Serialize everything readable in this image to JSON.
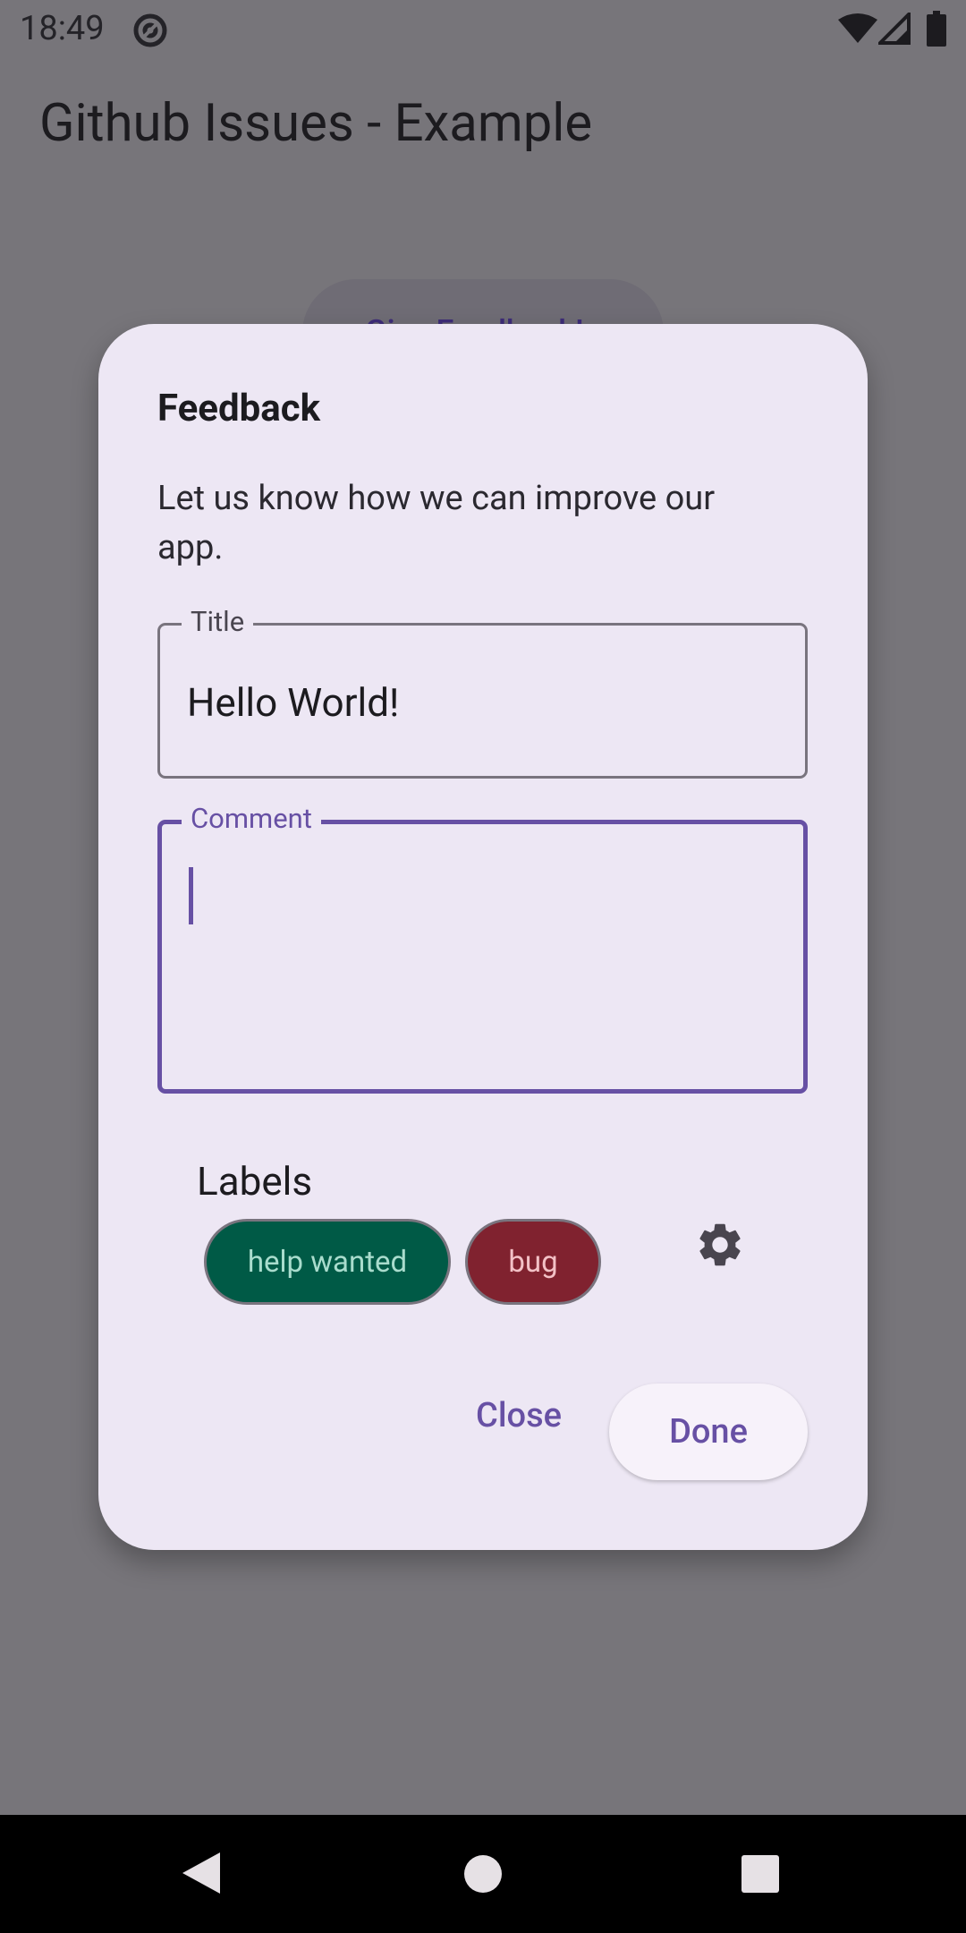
{
  "status_bar": {
    "time": "18:49",
    "icons": [
      "at-sign-icon",
      "wifi-icon",
      "cell-signal-icon",
      "battery-icon"
    ]
  },
  "app_bar": {
    "title": "Github Issues - Example"
  },
  "background": {
    "button_label": "Give Feedback!"
  },
  "dialog": {
    "title": "Feedback",
    "message": "Let us know how we can improve our app.",
    "title_field": {
      "label": "Title",
      "value": "Hello World!"
    },
    "comment_field": {
      "label": "Comment",
      "value": ""
    },
    "labels": {
      "heading": "Labels",
      "chips": [
        {
          "label": "help wanted",
          "color": "#005a46",
          "text_color": "#a9dccd"
        },
        {
          "label": "bug",
          "color": "#80222f",
          "text_color": "#f3c1c6"
        }
      ],
      "settings_icon": "gear-icon"
    },
    "actions": {
      "close_label": "Close",
      "done_label": "Done"
    }
  },
  "colors": {
    "primary": "#6750a4",
    "dialog_surface": "#ede7f4",
    "scrim": "#77757a"
  },
  "nav_bar": {
    "icons": [
      "back-icon",
      "home-icon",
      "recents-icon"
    ]
  }
}
